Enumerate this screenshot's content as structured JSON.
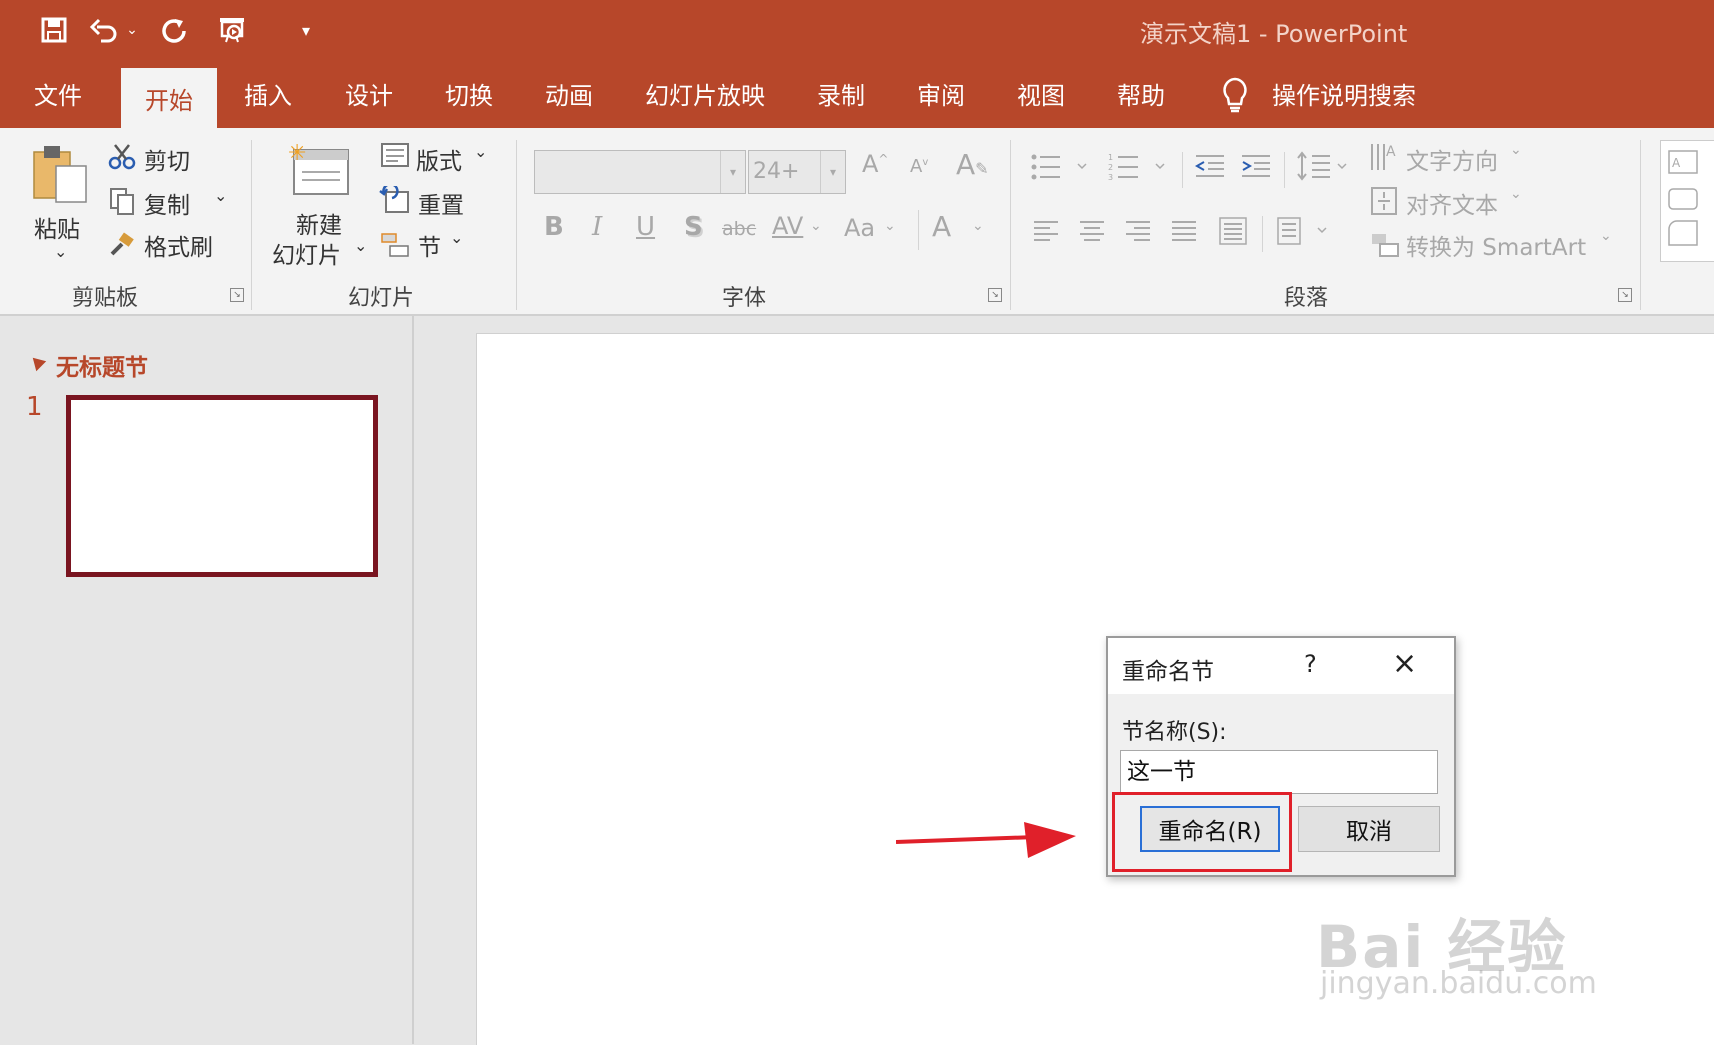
{
  "window": {
    "title": "演示文稿1  -  PowerPoint"
  },
  "quick_access": {
    "save_icon": "save-icon",
    "undo_icon": "undo-icon",
    "redo_icon": "repeat-icon",
    "present_icon": "present-icon",
    "customize_icon": "customize-qat-icon"
  },
  "tabs": [
    "文件",
    "开始",
    "插入",
    "设计",
    "切换",
    "动画",
    "幻灯片放映",
    "录制",
    "审阅",
    "视图",
    "帮助"
  ],
  "tell_me": "操作说明搜索",
  "ribbon": {
    "clipboard": {
      "paste": "粘贴",
      "cut": "剪切",
      "copy": "复制",
      "format_painter": "格式刷",
      "group": "剪贴板"
    },
    "slides": {
      "new_slide_1": "新建",
      "new_slide_2": "幻灯片",
      "layout": "版式",
      "reset": "重置",
      "section": "节",
      "group": "幻灯片"
    },
    "font": {
      "size": "24+",
      "bold": "B",
      "italic": "I",
      "underline": "U",
      "shadow": "S",
      "strike": "abc",
      "spacing": "AV",
      "case": "Aa",
      "color": "A",
      "group": "字体"
    },
    "paragraph": {
      "text_direction": "文字方向",
      "align_text": "对齐文本",
      "smartart": "转换为 SmartArt",
      "group": "段落"
    }
  },
  "slides_pane": {
    "section_title": "无标题节",
    "slide_number": "1"
  },
  "dialog": {
    "title": "重命名节",
    "help": "?",
    "close": "×",
    "label": "节名称(S):",
    "value": "这一节",
    "rename": "重命名(R)",
    "cancel": "取消"
  },
  "watermark": {
    "line1": "Bai 经验",
    "line2": "jingyan.baidu.com"
  }
}
